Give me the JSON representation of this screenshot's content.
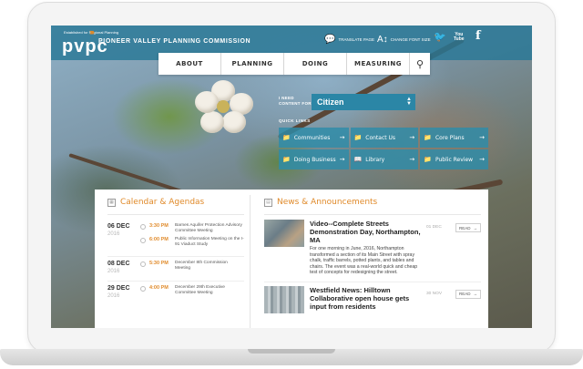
{
  "site": {
    "logo_tagline": "Established for Regional Planning",
    "logo_word": "pvpc",
    "org_name": "PIONEER VALLEY PLANNING COMMISSION",
    "translate_label": "TRANSLATE PAGE",
    "font_size_label": "CHANGE FONT SIZE",
    "social": {
      "twitter": "twitter-icon",
      "youtube_line1": "You",
      "youtube_line2": "Tube",
      "facebook": "f"
    }
  },
  "nav": {
    "items": [
      "ABOUT",
      "PLANNING",
      "DOING",
      "MEASURING"
    ],
    "search_icon": "search-icon"
  },
  "content_selector": {
    "label": "I NEED CONTENT FOR",
    "value": "Citizen"
  },
  "quick_links": {
    "label": "QUICK LINKS",
    "items": [
      "Communities",
      "Contact Us",
      "Core Plans",
      "Doing Business",
      "Library",
      "Public Review"
    ]
  },
  "calendar": {
    "title": "Calendar & Agendas",
    "days": [
      {
        "date": "06 DEC",
        "year": "2016",
        "events": [
          {
            "time": "3:30 PM",
            "text": "Barnes Aquifer Protection Advisory Committee Meeting"
          },
          {
            "time": "6:00 PM",
            "text": "Public Information Meeting on the I-91 Viaduct Study"
          }
        ]
      },
      {
        "date": "08 DEC",
        "year": "2016",
        "events": [
          {
            "time": "5:30 PM",
            "text": "December 8th Commission Meeting"
          }
        ]
      },
      {
        "date": "29 DEC",
        "year": "2016",
        "events": [
          {
            "time": "4:00 PM",
            "text": "December 29th Executive Committee Meeting"
          }
        ]
      }
    ]
  },
  "news": {
    "title": "News & Announcements",
    "read_label": "READ",
    "items": [
      {
        "title": "Video--Complete Streets Demonstration Day, Northampton, MA",
        "summary": "For one morning in June, 2016, Northampton transformed a section of its Main Street with spray chalk, traffic barrels, potted plants, and tables and chairs. The event was a real-world quick and cheap test of concepts for redesigning the street.",
        "date": "01 DEC"
      },
      {
        "title": "Westfield News: Hilltown Collaborative open house gets input from residents",
        "summary": "",
        "date": "30 NOV"
      }
    ]
  }
}
